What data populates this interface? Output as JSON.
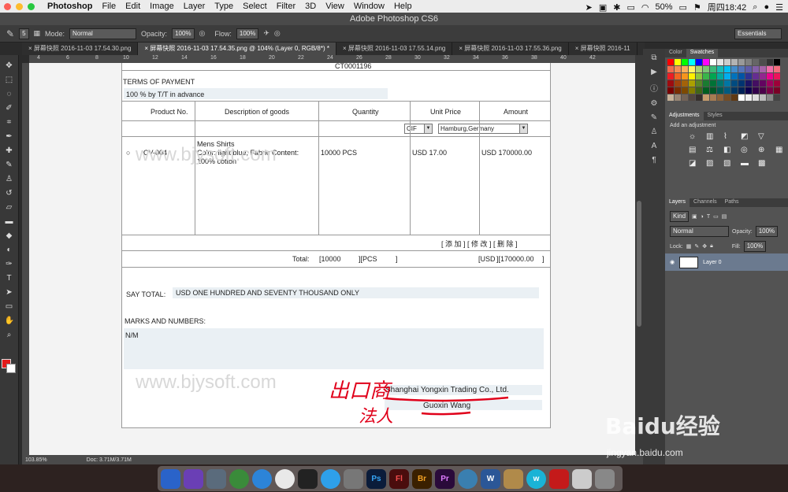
{
  "menubar": {
    "app_name": "Photoshop",
    "menus": [
      "File",
      "Edit",
      "Image",
      "Layer",
      "Type",
      "Select",
      "Filter",
      "3D",
      "View",
      "Window",
      "Help"
    ],
    "battery": "50%",
    "clock": "周四18:42"
  },
  "window": {
    "title": "Adobe Photoshop CS6"
  },
  "options_bar": {
    "brush_size": "5",
    "mode_label": "Mode:",
    "mode_value": "Normal",
    "opacity_label": "Opacity:",
    "opacity_value": "100%",
    "flow_label": "Flow:",
    "flow_value": "100%",
    "workspace": "Essentials"
  },
  "tabs": [
    {
      "label": "屏幕快照 2016-11-03 17.54.30.png"
    },
    {
      "label": "屏幕快照 2016-11-03 17.54.35.png @ 104% (Layer 0, RGB/8*) *"
    },
    {
      "label": "屏幕快照 2016-11-03 17.55.14.png"
    },
    {
      "label": "屏幕快照 2016-11-03 17.55.36.png"
    },
    {
      "label": "屏幕快照 2016-11"
    }
  ],
  "ruler_ticks": [
    "4",
    "6",
    "8",
    "10",
    "12",
    "14",
    "16",
    "18",
    "20",
    "22",
    "24",
    "26",
    "28",
    "30",
    "32",
    "34",
    "36",
    "38",
    "40",
    "42"
  ],
  "document": {
    "top_code": "CT0001196",
    "terms_label": "TERMS OF PAYMENT",
    "terms_value": "100 % by T/T in advance",
    "table_headers": [
      "Product No.",
      "Description of goods",
      "Quantity",
      "Unit Price",
      "Amount"
    ],
    "incoterm": "CIF",
    "port": "Hamburg,Germany",
    "product_no": "CV-004",
    "desc_line1": "Mens Shirts",
    "desc_line2": "Color: light blue, Fabric Content:",
    "desc_line3": "100% cotton",
    "quantity": "10000 PCS",
    "unit_price": "USD 17.00",
    "amount": "USD 170000.00",
    "actions": "[ 添 加 ] [ 修 改 ] [ 删 除 ]",
    "total_label": "Total:",
    "total_qty": "[10000",
    "total_unit": "][PCS",
    "total_close": "]",
    "total_currency": "[USD",
    "total_amount": "][170000.00",
    "total_amount_close": "]",
    "say_total_label": "SAY TOTAL:",
    "say_total_value": "USD ONE HUNDRED AND SEVENTY THOUSAND ONLY",
    "marks_label": "MARKS AND NUMBERS:",
    "marks_value": "N/M",
    "company": "Shanghai Yongxin Trading Co., Ltd.",
    "legal_person": "Guoxin Wang",
    "watermark": "www.bjysoft.com",
    "annot_exporter": "出口商",
    "annot_legal": "法人"
  },
  "status": {
    "zoom": "103.85%",
    "doc": "Doc: 3.71M/3.71M"
  },
  "panels": {
    "color_tabs": [
      "Color",
      "Swatches"
    ],
    "adj_tabs": [
      "Adjustments",
      "Styles"
    ],
    "add_adjustment": "Add an adjustment",
    "layer_tabs": [
      "Layers",
      "Channels",
      "Paths"
    ],
    "kind": "Kind",
    "blend": "Normal",
    "opacity_label": "Opacity:",
    "opacity_value": "100%",
    "lock_label": "Lock:",
    "fill_label": "Fill:",
    "fill_value": "100%",
    "layer_name": "Layer 0"
  },
  "brand": {
    "baidu": "Baidu经验",
    "baidu_url": "jingyan.baidu.com"
  },
  "colors": {
    "accent_red": "#e0001a",
    "fg_swatch": "#e21a1a"
  }
}
